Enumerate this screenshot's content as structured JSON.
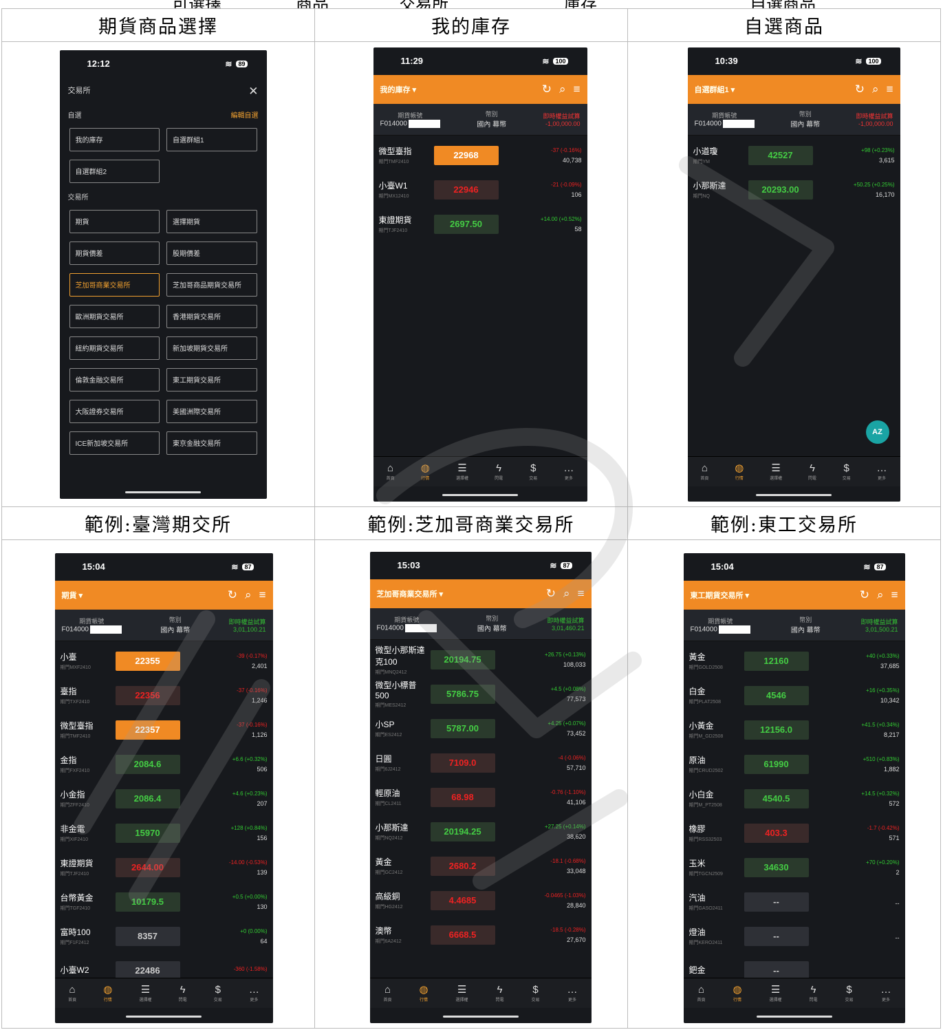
{
  "headers": [
    "期貨商品選擇",
    "我的庫存",
    "自選商品",
    "範例:臺灣期交所",
    "範例:芝加哥商業交易所",
    "範例:東工交易所"
  ],
  "top_partial": [
    "可選擇",
    "商品",
    "交易所",
    "庫存",
    "自選商品"
  ],
  "nav": [
    {
      "icon": "⌂",
      "label": "首頁"
    },
    {
      "icon": "◍",
      "label": "行情"
    },
    {
      "icon": "☰",
      "label": "選擇權"
    },
    {
      "icon": "ϟ",
      "label": "閃電"
    },
    {
      "icon": "$",
      "label": "交易"
    },
    {
      "icon": "…",
      "label": "更多"
    }
  ],
  "account": {
    "label": "期貨帳號",
    "id": "F014000",
    "currency_label": "幣別",
    "currency": "國內 幕幣",
    "equity_label": "即時權益試算"
  },
  "phones": [
    {
      "time": "12:12",
      "battery": "89",
      "exchange_title": "交易所",
      "close": "✕",
      "self_label": "自選",
      "edit_label": "編輯自選",
      "self_buttons": [
        "我的庫存",
        "自選群組1",
        "自選群組2"
      ],
      "exch_label": "交易所",
      "exch_buttons": [
        "期貨",
        "選擇期貨",
        "期貨價差",
        "股期價差",
        "芝加哥商業交易所",
        "芝加哥商品期貨交易所",
        "歐洲期貨交易所",
        "香港期貨交易所",
        "紐約期貨交易所",
        "新加坡期貨交易所",
        "倫敦金融交易所",
        "東工期貨交易所",
        "大阪證券交易所",
        "美國洲際交易所",
        "ICE新加坡交易所",
        "東京金融交易所"
      ]
    },
    {
      "time": "11:29",
      "battery": "100",
      "title": "我的庫存 ▾",
      "balance": "-1,00,000.00",
      "rows": [
        {
          "name": "微型臺指",
          "code": "期門TMF2410",
          "price": "22968",
          "style": "o",
          "chg": "-37 (-0.16%)",
          "cs": "r",
          "vol": "40,738"
        },
        {
          "name": "小臺W1",
          "code": "期門MX12410",
          "price": "22946",
          "style": "r",
          "chg": "-21 (-0.09%)",
          "cs": "r",
          "vol": "106"
        },
        {
          "name": "東證期貨",
          "code": "期門TJF2410",
          "price": "2697.50",
          "style": "g",
          "chg": "+14.00 (+0.52%)",
          "cs": "g",
          "vol": "58"
        }
      ]
    },
    {
      "time": "10:39",
      "battery": "100",
      "title": "自選群組1 ▾",
      "balance": "-1,00,000.00",
      "fab": "AZ",
      "rows": [
        {
          "name": "小道瓊",
          "code": "期門YM",
          "price": "42527",
          "style": "g",
          "chg": "+98 (+0.23%)",
          "cs": "g",
          "vol": "3,615"
        },
        {
          "name": "小那斯達",
          "code": "期門NQ",
          "price": "20293.00",
          "style": "g",
          "chg": "+50.25 (+0.25%)",
          "cs": "g",
          "vol": "16,170"
        }
      ]
    },
    {
      "time": "15:04",
      "battery": "87",
      "title": "期貨 ▾",
      "balance": "3,01,100.21",
      "rows": [
        {
          "name": "小臺",
          "code": "期門MXF2410",
          "price": "22355",
          "style": "o",
          "chg": "-39 (-0.17%)",
          "cs": "r",
          "vol": "2,401"
        },
        {
          "name": "臺指",
          "code": "期門TXF2410",
          "price": "22356",
          "style": "r",
          "chg": "-37 (-0.16%)",
          "cs": "r",
          "vol": "1,246"
        },
        {
          "name": "微型臺指",
          "code": "期門TMF2410",
          "price": "22357",
          "style": "o",
          "chg": "-37 (-0.16%)",
          "cs": "r",
          "vol": "1,126"
        },
        {
          "name": "金指",
          "code": "期門FXF2410",
          "price": "2084.6",
          "style": "g",
          "chg": "+6.6 (+0.32%)",
          "cs": "g",
          "vol": "506"
        },
        {
          "name": "小金指",
          "code": "期門ZFF2410",
          "price": "2086.4",
          "style": "g",
          "chg": "+4.6 (+0.23%)",
          "cs": "g",
          "vol": "207"
        },
        {
          "name": "非金電",
          "code": "期門XIF2410",
          "price": "15970",
          "style": "g",
          "chg": "+128 (+0.84%)",
          "cs": "g",
          "vol": "156"
        },
        {
          "name": "東證期貨",
          "code": "期門TJF2410",
          "price": "2644.00",
          "style": "r",
          "chg": "-14.00 (-0.53%)",
          "cs": "r",
          "vol": "139"
        },
        {
          "name": "台幣黃金",
          "code": "期門TGF2410",
          "price": "10179.5",
          "style": "g",
          "chg": "+0.5 (+0.00%)",
          "cs": "g",
          "vol": "130"
        },
        {
          "name": "富時100",
          "code": "期門F1F2412",
          "price": "8357",
          "style": "n",
          "chg": "+0 (0.00%)",
          "cs": "g",
          "vol": "64"
        },
        {
          "name": "小臺W2",
          "code": "",
          "price": "22486",
          "style": "n",
          "chg": "-360 (-1.58%)",
          "cs": "r",
          "vol": ""
        }
      ]
    },
    {
      "time": "15:03",
      "battery": "87",
      "title": "芝加哥商業交易所 ▾",
      "balance": "3,01,460.21",
      "rows": [
        {
          "name": "微型小那斯達克100",
          "code": "期門MNQ2412",
          "price": "20194.75",
          "style": "g",
          "chg": "+26.75 (+0.13%)",
          "cs": "g",
          "vol": "108,033"
        },
        {
          "name": "微型小標普500",
          "code": "期門MES2412",
          "price": "5786.75",
          "style": "g",
          "chg": "+4.5 (+0.08%)",
          "cs": "g",
          "vol": "77,573"
        },
        {
          "name": "小SP",
          "code": "期門ES2412",
          "price": "5787.00",
          "style": "g",
          "chg": "+4.25 (+0.07%)",
          "cs": "g",
          "vol": "73,452"
        },
        {
          "name": "日圓",
          "code": "期門6J2412",
          "price": "7109.0",
          "style": "r",
          "chg": "-4 (-0.06%)",
          "cs": "r",
          "vol": "57,710"
        },
        {
          "name": "輕原油",
          "code": "期門CL2411",
          "price": "68.98",
          "style": "r",
          "chg": "-0.76 (-1.10%)",
          "cs": "r",
          "vol": "41,106"
        },
        {
          "name": "小那斯達",
          "code": "期門NQ2412",
          "price": "20194.25",
          "style": "g",
          "chg": "+27.25 (+0.14%)",
          "cs": "g",
          "vol": "38,620"
        },
        {
          "name": "黃金",
          "code": "期門GC2412",
          "price": "2680.2",
          "style": "r",
          "chg": "-18.1 (-0.68%)",
          "cs": "r",
          "vol": "33,048"
        },
        {
          "name": "高級銅",
          "code": "期門HG2412",
          "price": "4.4685",
          "style": "r",
          "chg": "-0.0465 (-1.03%)",
          "cs": "r",
          "vol": "28,840"
        },
        {
          "name": "澳幣",
          "code": "期門6A2412",
          "price": "6668.5",
          "style": "r",
          "chg": "-18.5 (-0.28%)",
          "cs": "r",
          "vol": "27,670"
        }
      ]
    },
    {
      "time": "15:04",
      "battery": "87",
      "title": "東工期貨交易所 ▾",
      "balance": "3,01,500.21",
      "rows": [
        {
          "name": "黃金",
          "code": "期門GOLD2508",
          "price": "12160",
          "style": "g",
          "chg": "+40 (+0.33%)",
          "cs": "g",
          "vol": "37,685"
        },
        {
          "name": "白金",
          "code": "期門PLAT2508",
          "price": "4546",
          "style": "g",
          "chg": "+16 (+0.35%)",
          "cs": "g",
          "vol": "10,342"
        },
        {
          "name": "小黃金",
          "code": "期門M_GD2508",
          "price": "12156.0",
          "style": "g",
          "chg": "+41.5 (+0.34%)",
          "cs": "g",
          "vol": "8,217"
        },
        {
          "name": "原油",
          "code": "期門CRUD2502",
          "price": "61990",
          "style": "g",
          "chg": "+510 (+0.83%)",
          "cs": "g",
          "vol": "1,882"
        },
        {
          "name": "小白金",
          "code": "期門M_PT2508",
          "price": "4540.5",
          "style": "g",
          "chg": "+14.5 (+0.32%)",
          "cs": "g",
          "vol": "572"
        },
        {
          "name": "橡膠",
          "code": "期門RSS32503",
          "price": "403.3",
          "style": "r",
          "chg": "-1.7 (-0.42%)",
          "cs": "r",
          "vol": "571"
        },
        {
          "name": "玉米",
          "code": "期門TGCN2509",
          "price": "34630",
          "style": "g",
          "chg": "+70 (+0.20%)",
          "cs": "g",
          "vol": "2"
        },
        {
          "name": "汽油",
          "code": "期門GASO2411",
          "price": "--",
          "style": "n",
          "chg": "",
          "cs": "n",
          "vol": "--"
        },
        {
          "name": "燈油",
          "code": "期門KERO2411",
          "price": "--",
          "style": "n",
          "chg": "",
          "cs": "n",
          "vol": "--"
        },
        {
          "name": "鈀金",
          "code": "",
          "price": "--",
          "style": "n",
          "chg": "",
          "cs": "n",
          "vol": ""
        }
      ]
    }
  ]
}
